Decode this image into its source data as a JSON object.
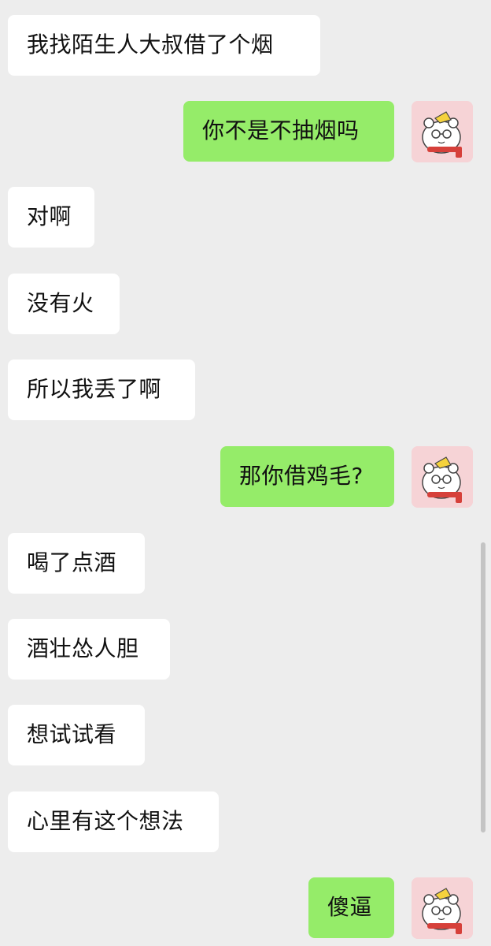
{
  "messages": [
    {
      "side": "in",
      "text": "我找陌生人大叔借了个烟"
    },
    {
      "side": "out",
      "text": "你不是不抽烟吗"
    },
    {
      "side": "in",
      "text": "对啊"
    },
    {
      "side": "in",
      "text": "没有火"
    },
    {
      "side": "in",
      "text": "所以我丢了啊"
    },
    {
      "side": "out",
      "text": "那你借鸡毛?"
    },
    {
      "side": "in",
      "text": "喝了点酒"
    },
    {
      "side": "in",
      "text": "酒壮怂人胆"
    },
    {
      "side": "in",
      "text": "想试试看"
    },
    {
      "side": "in",
      "text": "心里有这个想法"
    },
    {
      "side": "out",
      "text": "傻逼"
    }
  ],
  "colors": {
    "incoming": "#ffffff",
    "outgoing": "#95ec69",
    "background": "#ededed"
  },
  "avatar_icon": "cartoon-bear-avatar-icon"
}
